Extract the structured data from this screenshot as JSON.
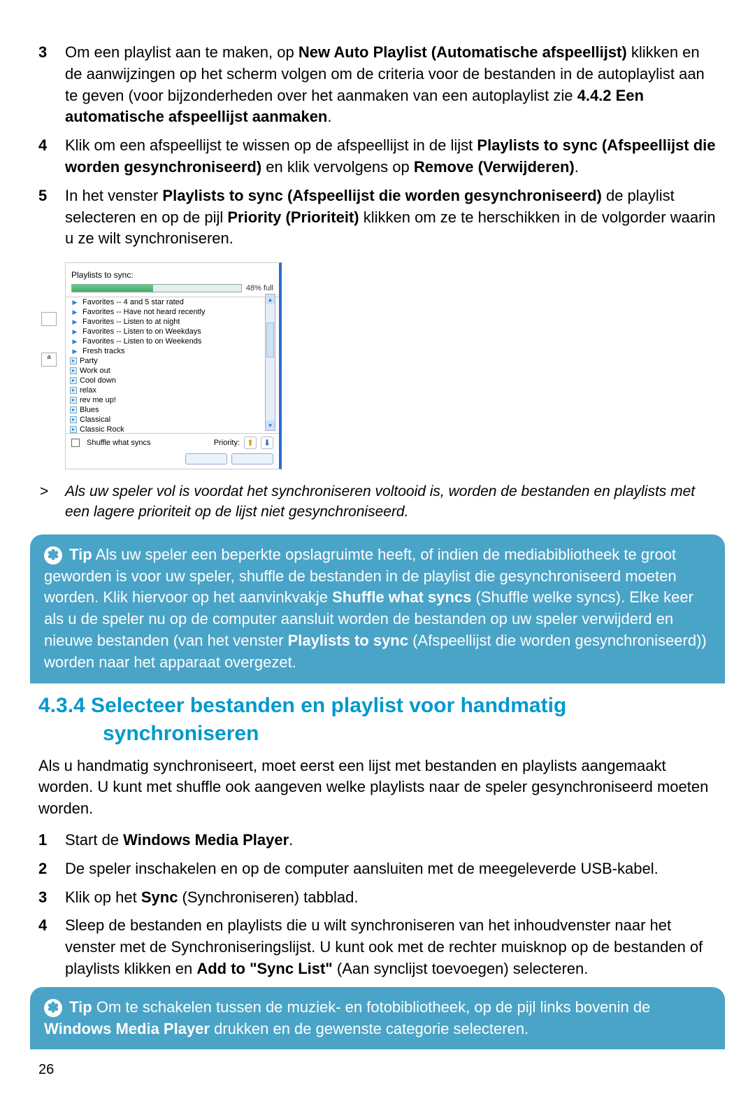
{
  "steps_a": [
    {
      "num": "3",
      "segments": [
        {
          "t": "Om een playlist aan te maken, op "
        },
        {
          "t": "New Auto Playlist (Automatische afspeellijst)",
          "b": true
        },
        {
          "t": " klikken en de aanwijzingen op het scherm volgen om de criteria voor de bestanden in de autoplaylist aan te geven (voor bijzonderheden over het aanmaken van een autoplaylist zie "
        },
        {
          "t": "4.4.2 Een automatische afspeellijst aanmaken",
          "b": true
        },
        {
          "t": "."
        }
      ]
    },
    {
      "num": "4",
      "segments": [
        {
          "t": "Klik om een afspeellijst te wissen op de afspeellijst in de lijst "
        },
        {
          "t": "Playlists to sync (Afspeellijst die worden gesynchroniseerd)",
          "b": true
        },
        {
          "t": " en klik vervolgens op "
        },
        {
          "t": "Remove (Verwijderen)",
          "b": true
        },
        {
          "t": "."
        }
      ]
    },
    {
      "num": "5",
      "segments": [
        {
          "t": "In het venster "
        },
        {
          "t": "Playlists to sync (Afspeellijst die worden gesynchroniseerd)",
          "b": true
        },
        {
          "t": " de playlist selecteren en op de pijl "
        },
        {
          "t": "Priority (Prioriteit)",
          "b": true
        },
        {
          "t": " klikken om ze te herschikken in de volgorder waarin u ze wilt synchroniseren."
        }
      ]
    }
  ],
  "sync_panel": {
    "title": "Playlists to sync:",
    "percent_label": "48% full",
    "fill_percent": 48,
    "items": [
      {
        "icon": "tri",
        "label": "Favorites -- 4 and 5 star rated"
      },
      {
        "icon": "tri",
        "label": "Favorites -- Have not heard recently"
      },
      {
        "icon": "tri",
        "label": "Favorites -- Listen to at night"
      },
      {
        "icon": "tri",
        "label": "Favorites -- Listen to on Weekdays"
      },
      {
        "icon": "tri",
        "label": "Favorites -- Listen to on Weekends"
      },
      {
        "icon": "tri",
        "label": "Fresh tracks"
      },
      {
        "icon": "sq",
        "label": "Party"
      },
      {
        "icon": "sq",
        "label": "Work out"
      },
      {
        "icon": "sq",
        "label": "Cool down"
      },
      {
        "icon": "sq",
        "label": "relax"
      },
      {
        "icon": "sq",
        "label": "rev me up!"
      },
      {
        "icon": "sq",
        "label": "Blues"
      },
      {
        "icon": "sq",
        "label": "Classical"
      },
      {
        "icon": "sq",
        "label": "Classic Rock"
      }
    ],
    "shuffle_label": "Shuffle what syncs",
    "priority_label": "Priority:"
  },
  "note": {
    "arrow": ">",
    "text": "Als uw speler vol is voordat het synchroniseren voltooid is, worden de bestanden en playlists met een lagere prioriteit op de lijst niet gesynchroniseerd."
  },
  "tip1": {
    "lead": "Tip",
    "segments": [
      {
        "t": " Als uw speler een beperkte opslagruimte heeft, of indien de mediabibliotheek te groot geworden is voor uw speler, shuffle de bestanden in de playlist die gesynchroniseerd moeten worden. Klik hiervoor op het aanvinkvakje "
      },
      {
        "t": "Shuffle what syncs",
        "b": true
      },
      {
        "t": " (Shuffle welke syncs). Elke keer als u de speler nu op de computer aansluit worden de bestanden op uw speler verwijderd en nieuwe bestanden (van het venster "
      },
      {
        "t": "Playlists to sync",
        "b": true
      },
      {
        "t": " (Afspeellijst die worden gesynchroniseerd)) worden naar het apparaat overgezet."
      }
    ]
  },
  "heading": {
    "num_title": "4.3.4 Selecteer bestanden en playlist voor handmatig",
    "line2": "synchroniseren"
  },
  "intro_para": "Als u handmatig synchroniseert, moet eerst een lijst met bestanden en playlists aangemaakt worden. U kunt met shuffle ook aangeven welke playlists naar de speler gesynchroniseerd moeten worden.",
  "steps_b": [
    {
      "num": "1",
      "segments": [
        {
          "t": "Start de "
        },
        {
          "t": "Windows Media Player",
          "b": true
        },
        {
          "t": "."
        }
      ]
    },
    {
      "num": "2",
      "segments": [
        {
          "t": "De speler inschakelen en op de computer aansluiten met de meegeleverde USB-kabel."
        }
      ]
    },
    {
      "num": "3",
      "segments": [
        {
          "t": "Klik op het "
        },
        {
          "t": "Sync",
          "b": true
        },
        {
          "t": " (Synchroniseren) tabblad."
        }
      ]
    },
    {
      "num": "4",
      "segments": [
        {
          "t": "Sleep de bestanden en playlists die u wilt synchroniseren van het inhoudvenster naar het venster met de Synchroniseringslijst. U kunt ook met de rechter muisknop op de bestanden of playlists klikken en "
        },
        {
          "t": "Add to \"Sync List\"",
          "b": true
        },
        {
          "t": " (Aan synclijst toevoegen) selecteren."
        }
      ]
    }
  ],
  "tip2": {
    "lead": "Tip",
    "segments": [
      {
        "t": " Om te schakelen tussen de muziek- en fotobibliotheek, op de pijl links bovenin de "
      },
      {
        "t": "Windows Media Player",
        "b": true
      },
      {
        "t": " drukken en de gewenste categorie selecteren."
      }
    ]
  },
  "page_number": "26"
}
